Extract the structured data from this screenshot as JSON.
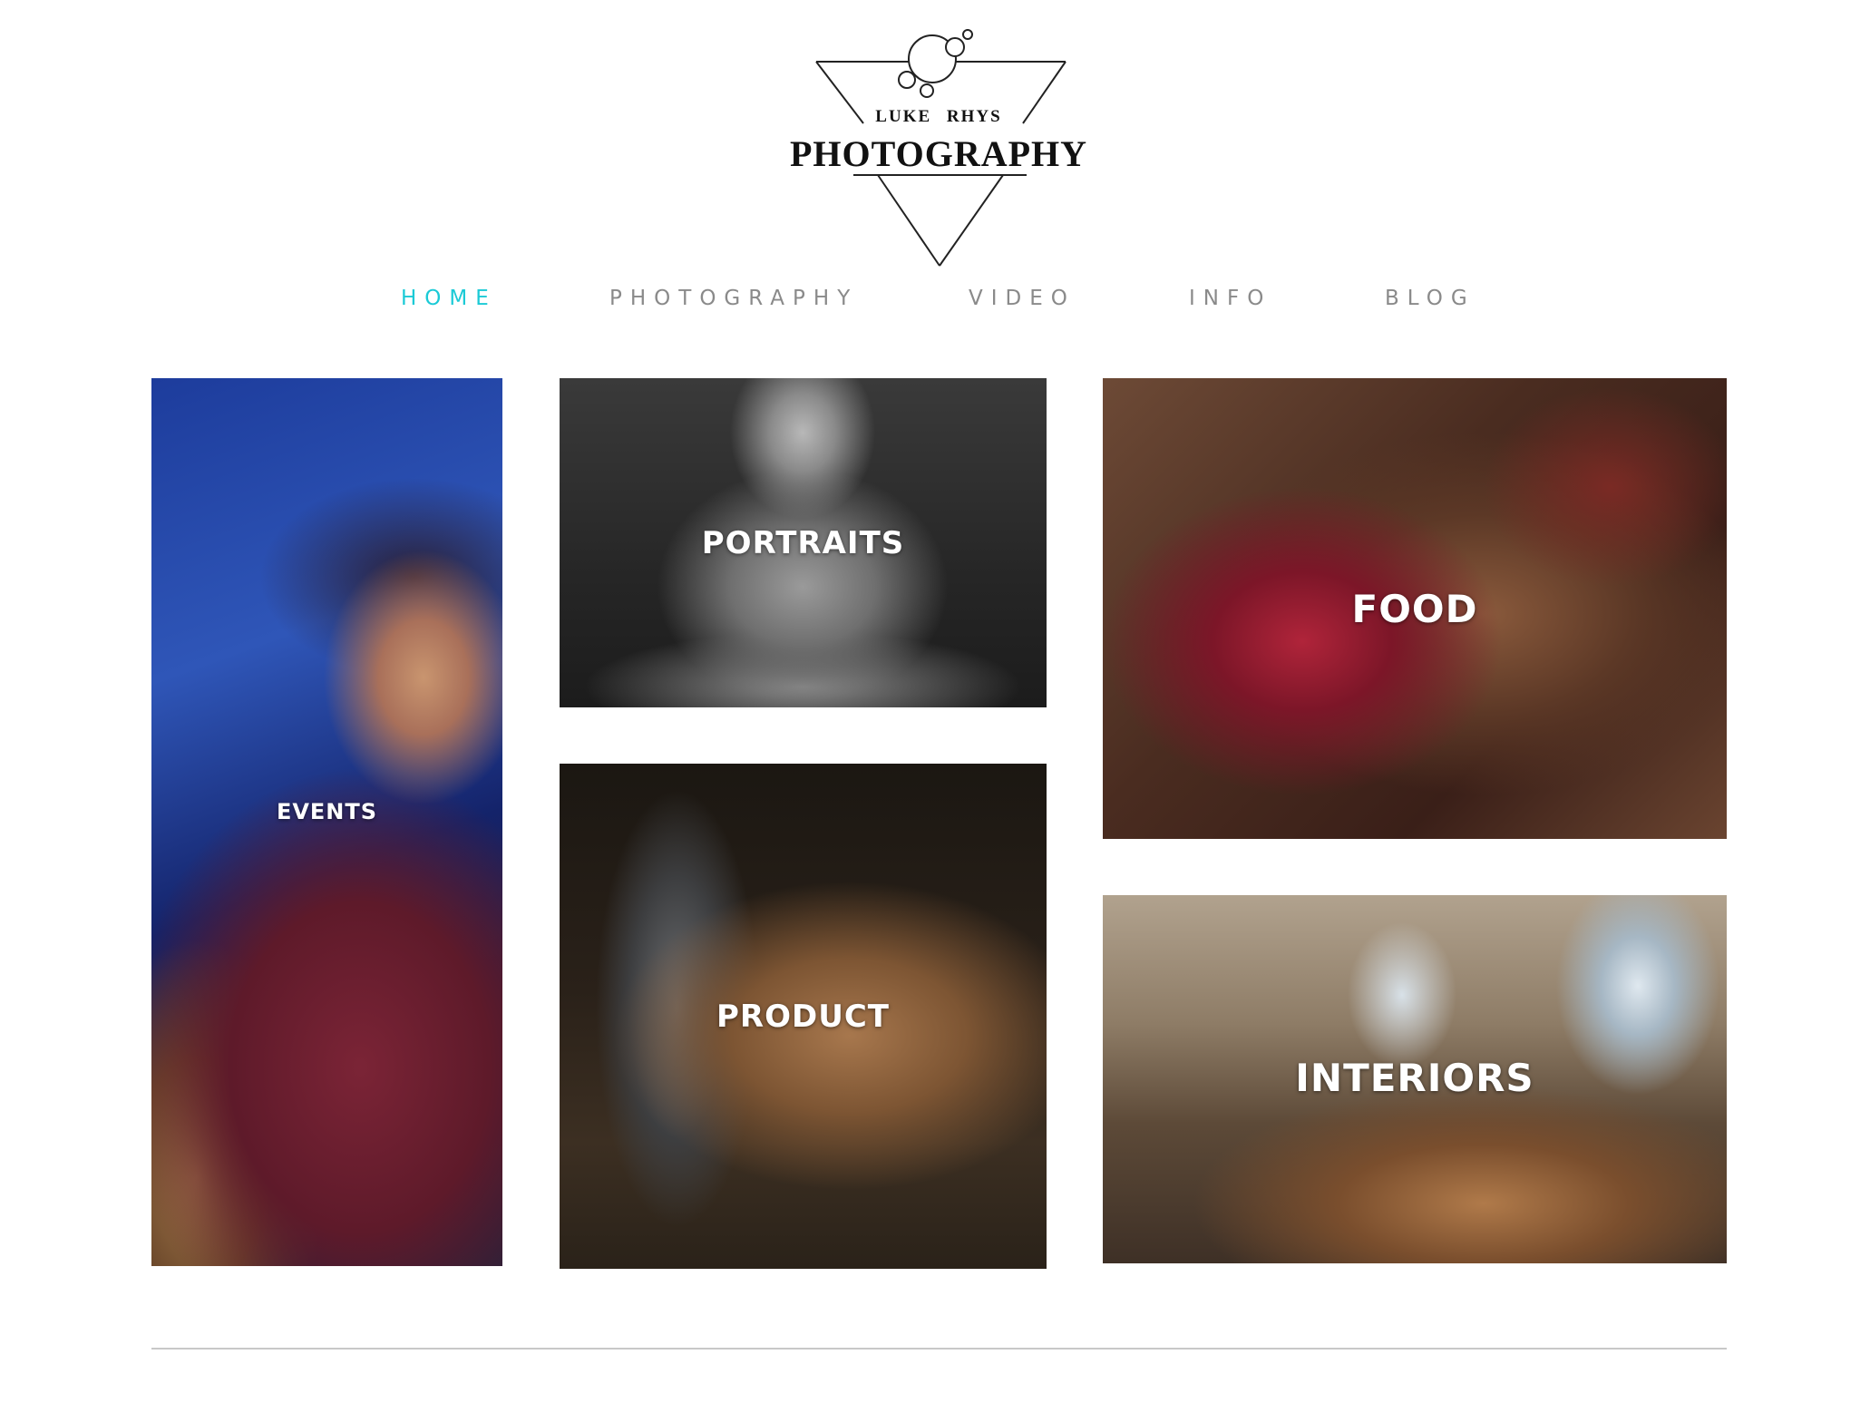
{
  "logo": {
    "name_line": "LUKE RHYS",
    "title_line": "PHOTOGRAPHY"
  },
  "nav": {
    "items": [
      {
        "label": "HOME",
        "active": true
      },
      {
        "label": "PHOTOGRAPHY",
        "active": false
      },
      {
        "label": "VIDEO",
        "active": false
      },
      {
        "label": "INFO",
        "active": false
      },
      {
        "label": "BLOG",
        "active": false
      }
    ],
    "active_color": "#1bcad6",
    "inactive_color": "#8a8a8a"
  },
  "gallery": {
    "events": {
      "label": "EVENTS"
    },
    "portraits": {
      "label": "PORTRAITS"
    },
    "product": {
      "label": "PRODUCT"
    },
    "food": {
      "label": "FOOD"
    },
    "interiors": {
      "label": "INTERIORS"
    }
  }
}
